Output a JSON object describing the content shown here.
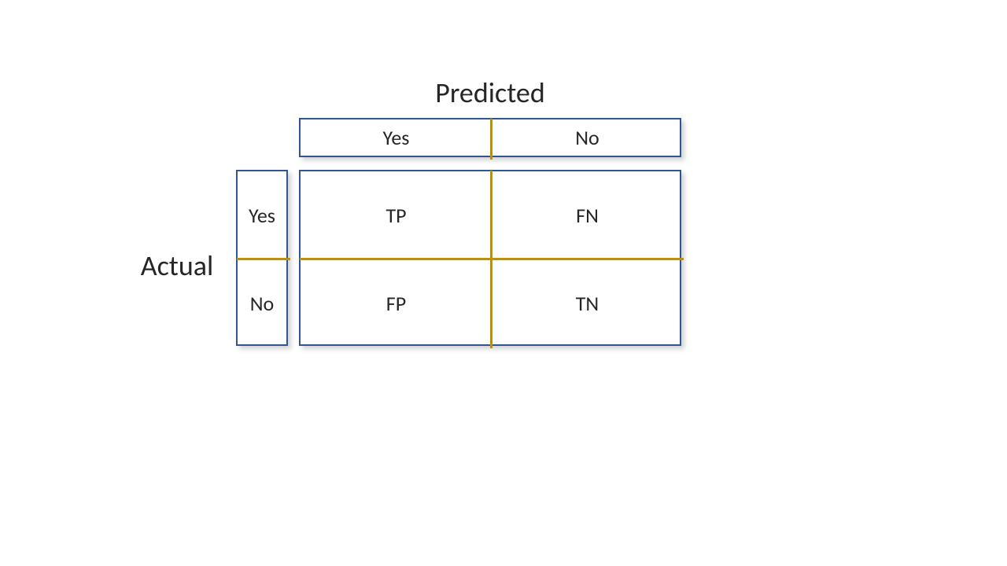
{
  "chart_data": {
    "type": "table",
    "title_col": "Predicted",
    "title_row": "Actual",
    "col_headers": [
      "Yes",
      "No"
    ],
    "row_headers": [
      "Yes",
      "No"
    ],
    "cells": [
      [
        "TP",
        "FN"
      ],
      [
        "FP",
        "TN"
      ]
    ]
  }
}
